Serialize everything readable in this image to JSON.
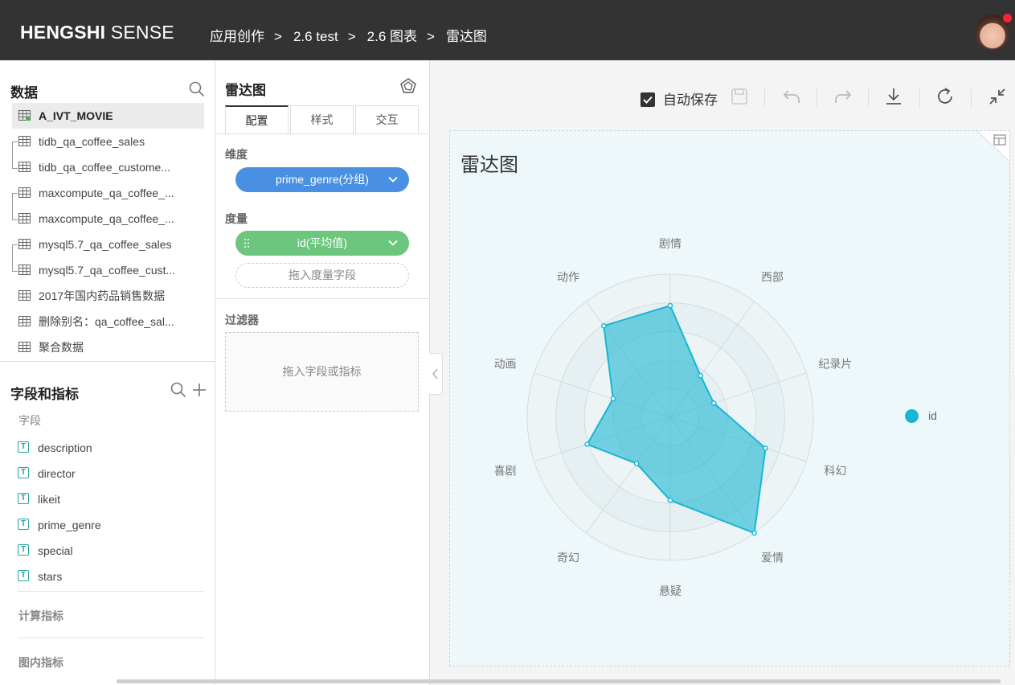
{
  "header": {
    "logo_bold": "HENGSHI",
    "logo_light": "SENSE",
    "breadcrumbs": [
      "应用创作",
      "2.6 test",
      "2.6 图表",
      "雷达图"
    ],
    "separator": ">"
  },
  "data_panel": {
    "title": "数据",
    "datasets": [
      {
        "label": "A_IVT_MOVIE",
        "selected": true
      },
      {
        "label": "tidb_qa_coffee_sales"
      },
      {
        "label": "tidb_qa_coffee_custome..."
      },
      {
        "label": "maxcompute_qa_coffee_..."
      },
      {
        "label": "maxcompute_qa_coffee_..."
      },
      {
        "label": "mysql5.7_qa_coffee_sales"
      },
      {
        "label": "mysql5.7_qa_coffee_cust..."
      },
      {
        "label": "2017年国内药品销售数据"
      },
      {
        "label": "删除别名：qa_coffee_sal..."
      },
      {
        "label": "聚合数据"
      }
    ]
  },
  "fields_panel": {
    "title": "字段和指标",
    "fields_label": "字段",
    "fields": [
      "description",
      "director",
      "likeit",
      "prime_genre",
      "special",
      "stars"
    ],
    "field_type_glyph": "T",
    "calc_label": "计算指标",
    "inchart_label": "图内指标"
  },
  "config_panel": {
    "title": "雷达图",
    "tabs": [
      "配置",
      "样式",
      "交互"
    ],
    "dimension_label": "维度",
    "dimension_pill": "prime_genre(分组)",
    "measure_label": "度量",
    "measure_pill": "id(平均值)",
    "measure_drop": "拖入度量字段",
    "filter_label": "过滤器",
    "filter_drop": "拖入字段或指标"
  },
  "toolbar": {
    "autosave_label": "自动保存",
    "autosave_checked": true
  },
  "colors": {
    "dimension_pill": "#4a90e2",
    "measure_pill": "#6cc67d",
    "series": "#17b6d2",
    "card_bg": "#eef8fb"
  },
  "chart_data": {
    "type": "radar",
    "title": "雷达图",
    "categories": [
      "剧情",
      "西部",
      "纪录片",
      "科幻",
      "爱情",
      "悬疑",
      "奇幻",
      "喜剧",
      "动画",
      "动作"
    ],
    "series": [
      {
        "name": "id",
        "values": [
          0.78,
          0.36,
          0.32,
          0.7,
          1.0,
          0.58,
          0.4,
          0.61,
          0.42,
          0.79
        ]
      }
    ],
    "rings": 5,
    "legend": "right"
  }
}
